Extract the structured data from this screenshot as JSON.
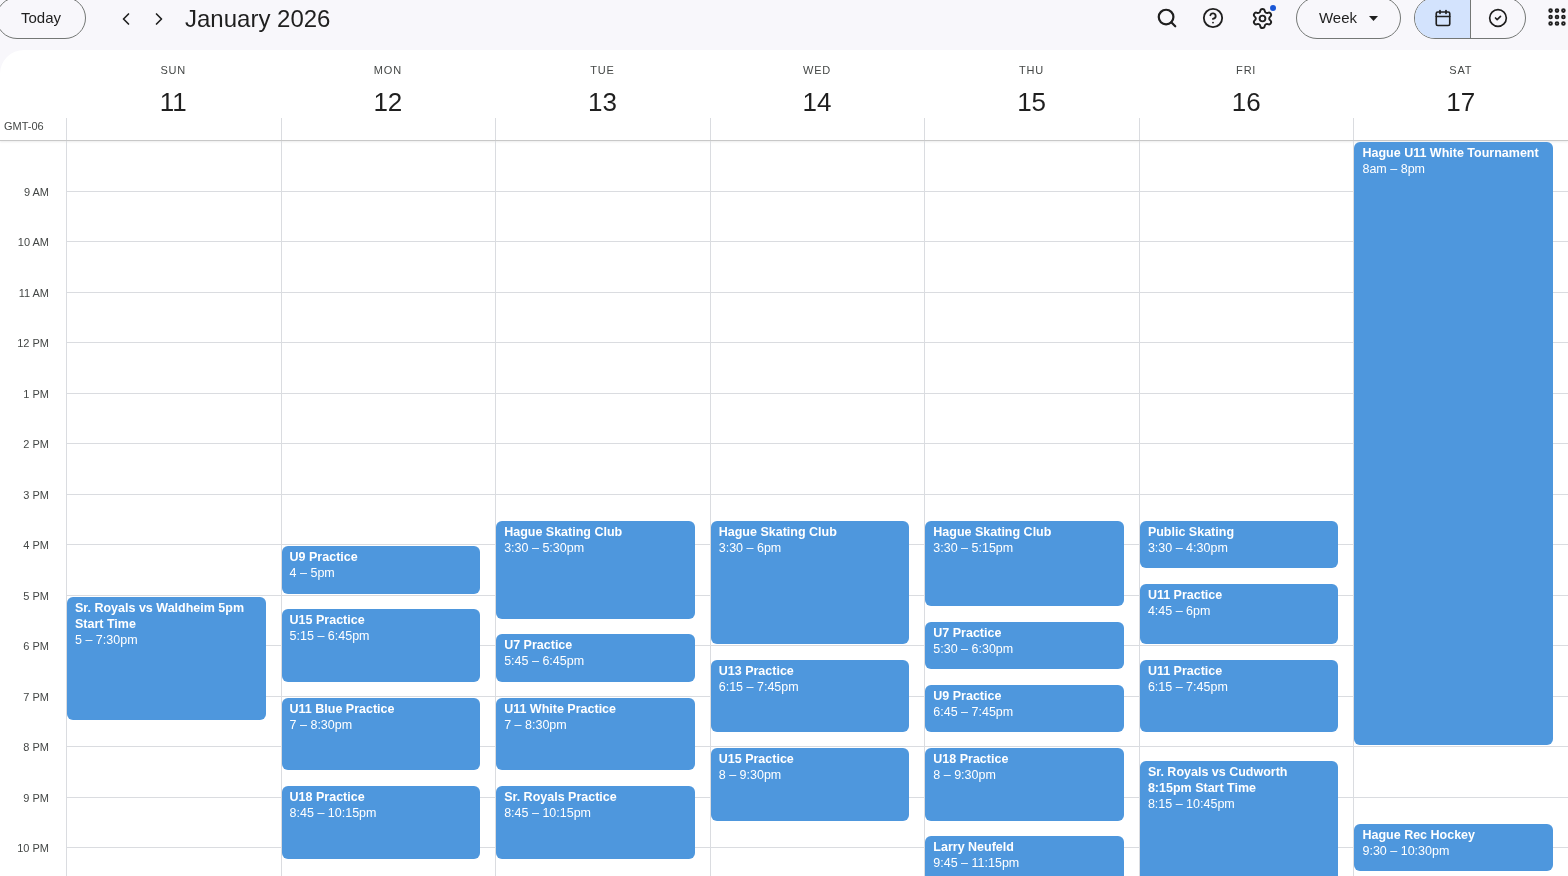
{
  "toolbar": {
    "today": "Today",
    "title": "January 2026",
    "settings_notification": true,
    "view": "Week",
    "view_toggle": [
      {
        "kind": "calendar",
        "selected": true
      },
      {
        "kind": "tasks",
        "selected": false
      }
    ]
  },
  "timezone": "GMT-06",
  "hours": [
    "9 AM",
    "10 AM",
    "11 AM",
    "12 PM",
    "1 PM",
    "2 PM",
    "3 PM",
    "4 PM",
    "5 PM",
    "6 PM",
    "7 PM",
    "8 PM",
    "9 PM",
    "10 PM"
  ],
  "days": [
    {
      "name": "SUN",
      "date": "11",
      "events": [
        {
          "title": "Sr. Royals vs Waldheim 5pm Start Time",
          "time": "5 – 7:30pm"
        }
      ]
    },
    {
      "name": "MON",
      "date": "12",
      "events": [
        {
          "title": "U9 Practice",
          "time": "4 – 5pm"
        },
        {
          "title": "U15 Practice",
          "time": "5:15 – 6:45pm"
        },
        {
          "title": "U11 Blue Practice",
          "time": "7 – 8:30pm"
        },
        {
          "title": "U18 Practice",
          "time": "8:45 – 10:15pm"
        }
      ]
    },
    {
      "name": "TUE",
      "date": "13",
      "events": [
        {
          "title": "Hague Skating Club",
          "time": "3:30 – 5:30pm"
        },
        {
          "title": "U7 Practice",
          "time": "5:45 – 6:45pm"
        },
        {
          "title": "U11 White Practice",
          "time": "7 – 8:30pm"
        },
        {
          "title": "Sr. Royals Practice",
          "time": "8:45 – 10:15pm"
        }
      ]
    },
    {
      "name": "WED",
      "date": "14",
      "events": [
        {
          "title": "Hague Skating Club",
          "time": "3:30 – 6pm"
        },
        {
          "title": "U13 Practice",
          "time": "6:15 – 7:45pm"
        },
        {
          "title": "U15 Practice",
          "time": "8 – 9:30pm"
        }
      ]
    },
    {
      "name": "THU",
      "date": "15",
      "events": [
        {
          "title": "Hague Skating Club",
          "time": "3:30 – 5:15pm"
        },
        {
          "title": "U7 Practice",
          "time": "5:30 – 6:30pm"
        },
        {
          "title": "U9 Practice",
          "time": "6:45 – 7:45pm"
        },
        {
          "title": "U18 Practice",
          "time": "8 – 9:30pm"
        },
        {
          "title": "Larry Neufeld",
          "time": "9:45 – 11:15pm"
        }
      ]
    },
    {
      "name": "FRI",
      "date": "16",
      "events": [
        {
          "title": "Public Skating",
          "time": "3:30 – 4:30pm"
        },
        {
          "title": "U11 Practice",
          "time": "4:45 – 6pm"
        },
        {
          "title": "U11 Practice",
          "time": "6:15 – 7:45pm"
        },
        {
          "title": "Sr. Royals vs Cudworth 8:15pm Start Time",
          "time": "8:15 – 10:45pm"
        }
      ]
    },
    {
      "name": "SAT",
      "date": "17",
      "events": [
        {
          "title": "Hague U11 White Tournament",
          "time": "8am – 8pm"
        },
        {
          "title": "Hague Rec Hockey",
          "time": "9:30 – 10:30pm"
        }
      ]
    }
  ]
}
